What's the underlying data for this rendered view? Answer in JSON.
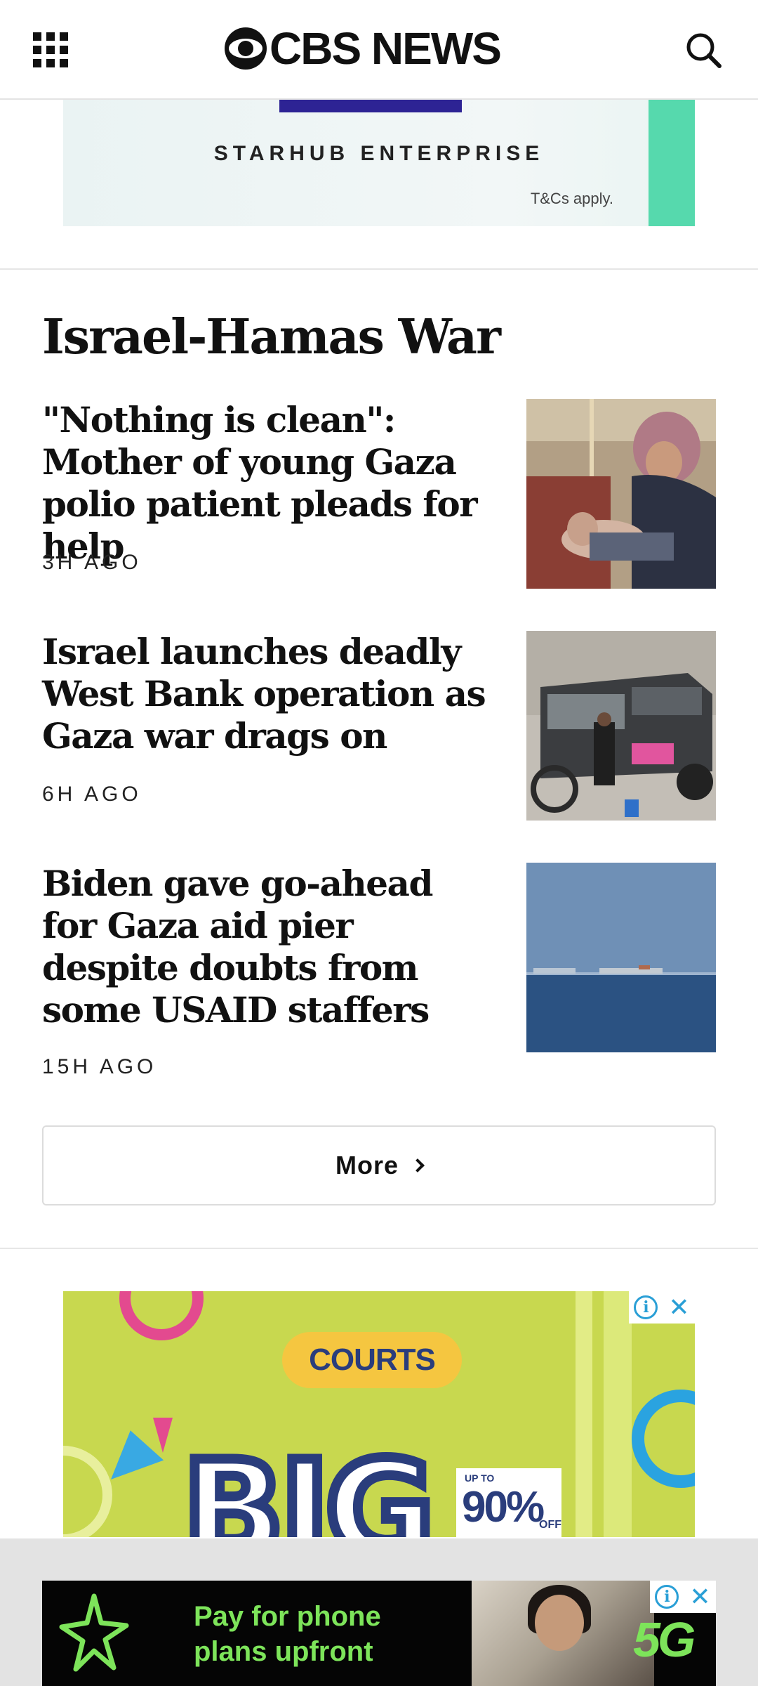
{
  "header": {
    "logo_text": "CBS NEWS",
    "menu_icon": "grid-menu-icon",
    "search_icon": "search-icon"
  },
  "ad_top": {
    "brand": "STARHUB ENTERPRISE",
    "terms": "T&Cs apply."
  },
  "section": {
    "title": "Israel-Hamas War",
    "articles": [
      {
        "headline": "\"Nothing is clean\": Mother of young Gaza polio patient pleads for help",
        "time": "3H AGO"
      },
      {
        "headline": "Israel launches deadly West Bank operation as Gaza war drags on",
        "time": "6H AGO"
      },
      {
        "headline": "Biden gave go-ahead for Gaza aid pier despite doubts from some USAID staffers",
        "time": "15H AGO"
      }
    ],
    "more_label": "More"
  },
  "ad_courts": {
    "brand": "COURTS",
    "big_text": "BIG",
    "upto": "UP TO",
    "percent": "90%",
    "off": "OFF"
  },
  "ad_bottom": {
    "line1": "Pay for phone",
    "line2": "plans upfront",
    "badge": "5G"
  },
  "colors": {
    "accent_blue": "#2a9fd6",
    "ad_green": "#7de45a",
    "courts_navy": "#2a3d7c"
  }
}
